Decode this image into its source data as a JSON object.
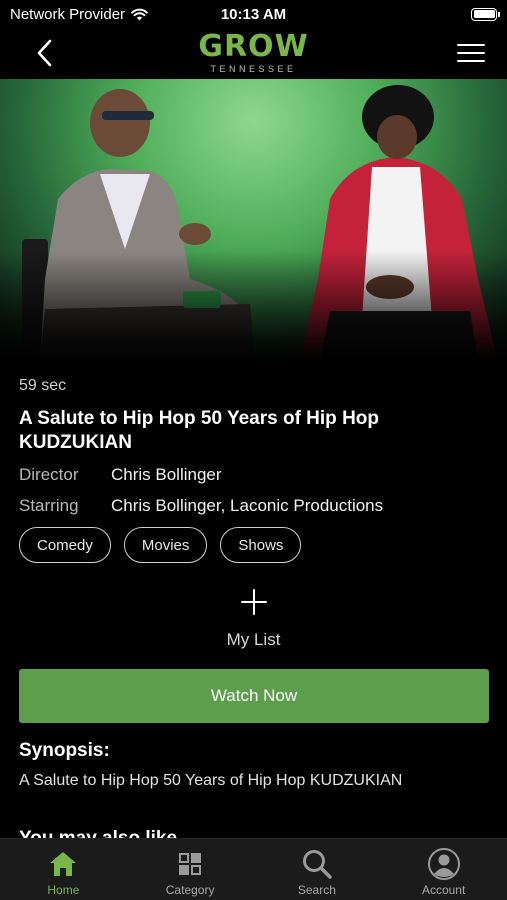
{
  "status_bar": {
    "carrier": "Network Provider",
    "time": "10:13 AM"
  },
  "header": {
    "logo_main": "GROW",
    "logo_sub": "TENNESSEE",
    "brand_color": "#7ab648"
  },
  "video": {
    "duration": "59 sec",
    "title": "A Salute to Hip Hop 50 Years of Hip Hop  KUDZUKIAN",
    "director_label": "Director",
    "director": "Chris Bollinger",
    "starring_label": "Starring",
    "starring": "Chris Bollinger, Laconic Productions",
    "tags": [
      "Comedy",
      "Movies",
      "Shows"
    ]
  },
  "actions": {
    "my_list_label": "My List",
    "watch_label": "Watch Now",
    "watch_color": "#5c9e4b"
  },
  "synopsis": {
    "heading": "Synopsis:",
    "text": "A Salute to Hip Hop 50 Years of Hip Hop  KUDZUKIAN"
  },
  "related": {
    "heading": "You may also like"
  },
  "tab_bar": {
    "items": [
      {
        "label": "Home",
        "icon": "home-icon",
        "active": true
      },
      {
        "label": "Category",
        "icon": "category-icon",
        "active": false
      },
      {
        "label": "Search",
        "icon": "search-icon",
        "active": false
      },
      {
        "label": "Account",
        "icon": "account-icon",
        "active": false
      }
    ]
  }
}
